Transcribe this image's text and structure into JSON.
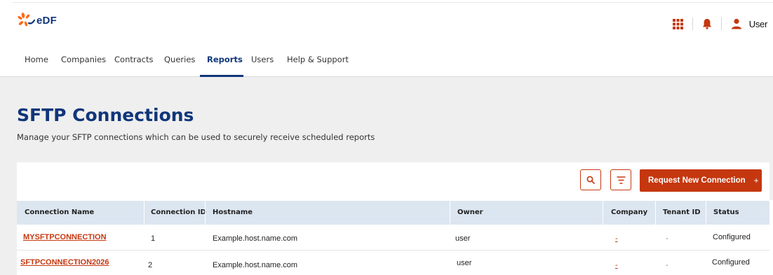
{
  "brand": {
    "logo_text": "eDF",
    "accent": "#c5370f",
    "primary": "#10367a",
    "logo_orange": "#ff6a13"
  },
  "header": {
    "apps_icon": "grid-icon",
    "notifications_icon": "bell-icon",
    "user_icon": "person-icon",
    "user_label": "User"
  },
  "nav": {
    "items": [
      {
        "label": "Home"
      },
      {
        "label": "Companies"
      },
      {
        "label": "Contracts"
      },
      {
        "label": "Queries"
      },
      {
        "label": "Reports",
        "active": true
      },
      {
        "label": "Users"
      },
      {
        "label": "Help & Support"
      }
    ]
  },
  "page": {
    "title": "SFTP Connections",
    "subtitle": "Manage your SFTP connections which can be used to securely receive scheduled reports"
  },
  "toolbar": {
    "search_icon": "search-icon",
    "filter_icon": "filter-icon",
    "request_label": "Request New Connection",
    "request_plus": "+"
  },
  "table": {
    "columns": [
      "Connection Name",
      "Connection ID",
      "Hostname",
      "Owner",
      "Company",
      "Tenant ID",
      "Status"
    ],
    "rows": [
      {
        "name": "MYSFTPCONNECTION",
        "id": "1",
        "hostname": "Example.host.name.com",
        "owner": "user",
        "company": "-",
        "tenant": "-",
        "status": "Configured"
      },
      {
        "name": "SFTPCONNECTION2026",
        "id": "2",
        "hostname": "Example.host.name.com",
        "owner": "user",
        "company": "-",
        "tenant": "-",
        "status": "Configured"
      }
    ]
  }
}
